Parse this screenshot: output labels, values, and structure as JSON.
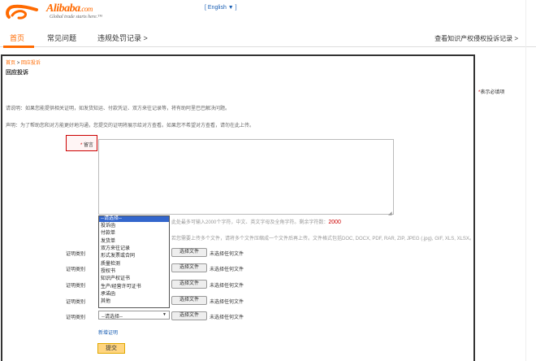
{
  "header": {
    "logo_name": "Alibaba",
    "logo_suffix": ".com",
    "logo_tagline": "Global trade starts here.™",
    "language": "[ English ▼ ]"
  },
  "nav": {
    "items": [
      "首页",
      "常见问题",
      "违规处罚记录 >"
    ],
    "right_link": "查看知识产权侵权投诉记录 >"
  },
  "page": {
    "breadcrumb_home": "首页",
    "breadcrumb_sep": ">",
    "breadcrumb_current": "回应投诉",
    "title": "回应投诉",
    "required_star": "*",
    "required_note": "表示必填项",
    "desc_1": "请说明：如果您能提供相关证明，如发货知运、付款凭证、双方来往记录等，将有助阿里巴巴解决问题。",
    "desc_2": "声明：为了帮助您和对方能更好地沟通，您提交的证明将展示给对方查看。如果您不希望对方查看，请勿在此上传。"
  },
  "message": {
    "star": "*",
    "label": "留言",
    "value": "",
    "hint_text": "此处最多可输入2000个字符，中文、英文字母及全角字符。剩余字符数：",
    "remaining": "2000",
    "upload_hint": "若您需要上传多个文件，请将多个文件压缩成一个文件后再上传。文件格式包括DOC, DOCX, PDF, RAR, ZIP, JPEG (.jpg), GIF, XLS, XLSX。"
  },
  "evidence": {
    "label": "证明类别",
    "file_button": "选择文件",
    "file_status": "未选择任何文件",
    "select_value": "--请选择--",
    "select_arrow": "▼",
    "add_link": "新增证明",
    "submit": "提交"
  },
  "dropdown": {
    "options": [
      "--请选择--",
      "投诉函",
      "付款单",
      "发货单",
      "双方来往记录",
      "形式发票或合同",
      "质量检测",
      "授权书",
      "知识产权证书",
      "生产/经营许可证书",
      "承诺函",
      "其他"
    ]
  },
  "colors": {
    "brand": "#ff6a00",
    "required": "#cc0000",
    "link": "#1a5fb4",
    "select_highlight": "#3366cc",
    "submit_bg": "#ffd580"
  }
}
